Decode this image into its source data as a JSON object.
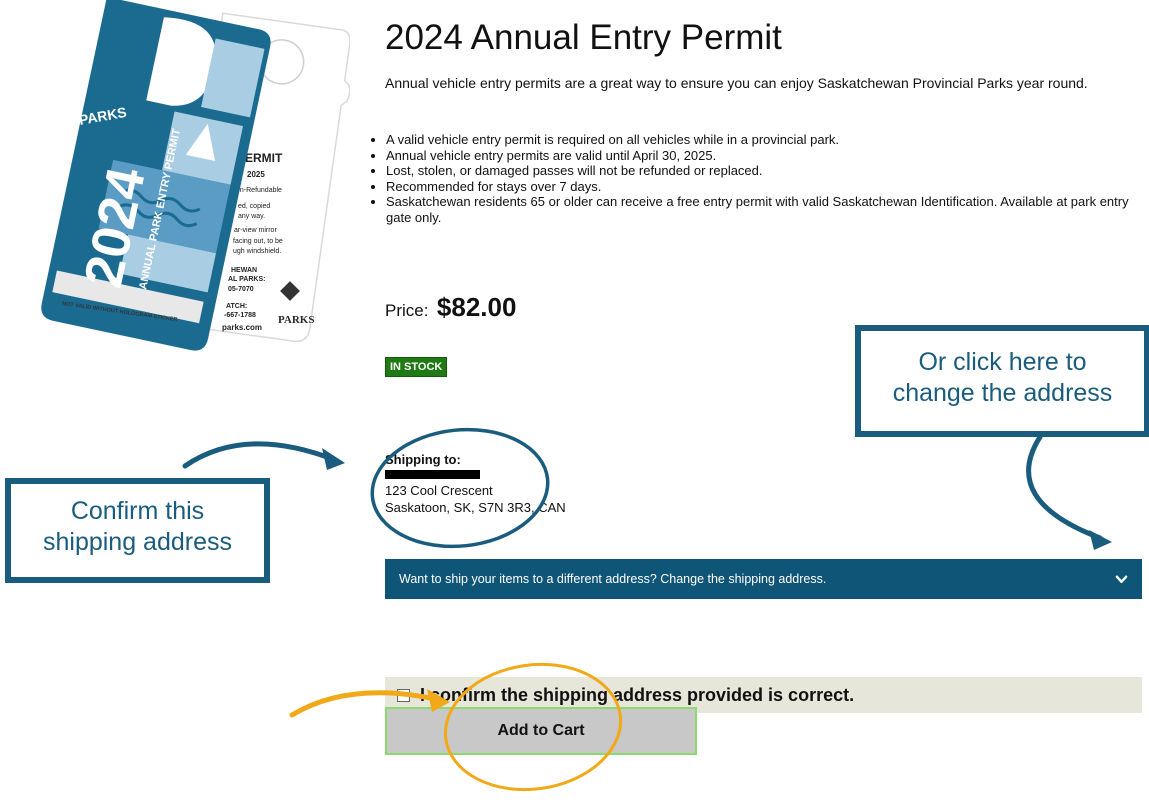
{
  "product": {
    "title": "2024 Annual Entry Permit",
    "description": "Annual vehicle entry permits are a great way to ensure you can enjoy Saskatchewan Provincial Parks year round.",
    "bullets": [
      "A valid vehicle entry permit is required on all vehicles while in a provincial park.",
      "Annual vehicle entry permits are valid until April 30, 2025.",
      "Lost, stolen, or damaged passes will not be refunded or replaced.",
      "Recommended for stays over 7 days.",
      "Saskatchewan residents 65 or older can receive a free entry permit with valid Saskatchewan Identification. Available at park entry gate only."
    ],
    "price_label": "Price:",
    "price": "$82.00",
    "stock_badge": "IN STOCK"
  },
  "permit_image": {
    "year": "2024",
    "side_text": "ANNUAL PARK ENTRY PERMIT",
    "brand": "PARKS",
    "sticker_text": "NOT VALID WITHOUT HOLOGRAM STICKER",
    "back_heading": "PERMIT",
    "back_lines": [
      "L",
      "2025",
      "on-Refundable",
      "ed, copied",
      "any way.",
      "ar-view mirror",
      "facing out, to be",
      "ugh windshield.",
      "HEWAN",
      "AL PARKS:",
      "05-7070",
      "ATCH:",
      "-667-1788",
      "parks.com"
    ],
    "colors": {
      "primary": "#1b6b91",
      "light": "#a9cde3",
      "mid": "#5a9cc4"
    }
  },
  "shipping": {
    "heading": "Shipping to:",
    "address_line1": "123 Cool Crescent",
    "address_line2": "Saskatoon, SK, S7N 3R3, CAN"
  },
  "change_address": {
    "label": "Want to ship your items to a different address? Change the shipping address."
  },
  "confirm": {
    "label": "I confirm the shipping address provided is correct."
  },
  "cart": {
    "add_label": "Add to Cart"
  },
  "callouts": {
    "left_line1": "Confirm this",
    "left_line2": "shipping address",
    "right_line1": "Or click here to",
    "right_line2": "change the address"
  },
  "colors": {
    "bar": "#0f5577",
    "callout": "#1a5c7e",
    "stock": "#1f7a14",
    "confirm_bg": "#e6e6da",
    "button_bg": "#c8c8c8",
    "button_border": "#8cd96c",
    "annotation_orange": "#f2a918"
  }
}
